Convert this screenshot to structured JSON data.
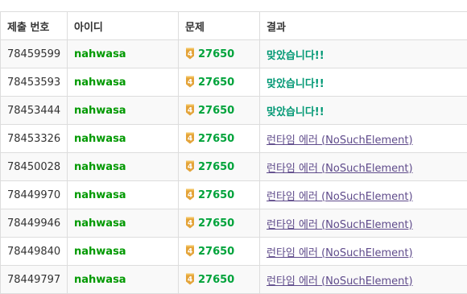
{
  "table": {
    "headers": [
      "제출 번호",
      "아이디",
      "문제",
      "결과"
    ],
    "rows": [
      {
        "id": "78459599",
        "user": "nahwasa",
        "tier": "4",
        "problem": "27650",
        "result": "맞았습니다!!",
        "result_type": "ac"
      },
      {
        "id": "78453593",
        "user": "nahwasa",
        "tier": "4",
        "problem": "27650",
        "result": "맞았습니다!!",
        "result_type": "ac"
      },
      {
        "id": "78453444",
        "user": "nahwasa",
        "tier": "4",
        "problem": "27650",
        "result": "맞았습니다!!",
        "result_type": "ac"
      },
      {
        "id": "78453326",
        "user": "nahwasa",
        "tier": "4",
        "problem": "27650",
        "result": "런타임 에러 (NoSuchElement)",
        "result_type": "re"
      },
      {
        "id": "78450028",
        "user": "nahwasa",
        "tier": "4",
        "problem": "27650",
        "result": "런타임 에러 (NoSuchElement)",
        "result_type": "re"
      },
      {
        "id": "78449970",
        "user": "nahwasa",
        "tier": "4",
        "problem": "27650",
        "result": "런타임 에러 (NoSuchElement)",
        "result_type": "re"
      },
      {
        "id": "78449946",
        "user": "nahwasa",
        "tier": "4",
        "problem": "27650",
        "result": "런타임 에러 (NoSuchElement)",
        "result_type": "re"
      },
      {
        "id": "78449840",
        "user": "nahwasa",
        "tier": "4",
        "problem": "27650",
        "result": "런타임 에러 (NoSuchElement)",
        "result_type": "re"
      },
      {
        "id": "78449797",
        "user": "nahwasa",
        "tier": "4",
        "problem": "27650",
        "result": "런타임 에러 (NoSuchElement)",
        "result_type": "re"
      }
    ]
  },
  "colors": {
    "user": "#009900",
    "problem": "#00a33b",
    "accepted": "#009874",
    "runtime_error": "#5f4b8b",
    "tier_badge": "#e4a43a"
  },
  "icons": {
    "tier": "gold-tier-badge-icon"
  }
}
